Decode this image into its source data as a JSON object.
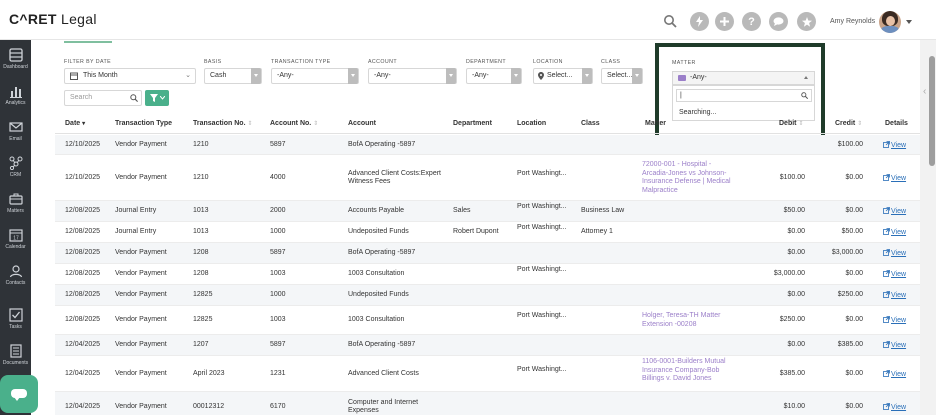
{
  "app": {
    "logo_main": "C^RET",
    "logo_sub": " Legal"
  },
  "header": {
    "user_name": "Amy Reynolds",
    "icons": [
      "search-icon",
      "bolt-icon",
      "plus-icon",
      "help-icon",
      "chat-icon",
      "star-icon"
    ]
  },
  "sidebar": {
    "items": [
      {
        "label": "Dashboard",
        "icon": "dashboard-icon"
      },
      {
        "label": "Analytics",
        "icon": "analytics-icon"
      },
      {
        "label": "Email",
        "icon": "email-icon"
      },
      {
        "label": "CRM",
        "icon": "crm-icon"
      },
      {
        "label": "Matters",
        "icon": "matters-icon"
      },
      {
        "label": "Calendar",
        "icon": "calendar-icon"
      },
      {
        "label": "Contacts",
        "icon": "contacts-icon"
      },
      {
        "label": "Tasks",
        "icon": "tasks-icon"
      },
      {
        "label": "Documents",
        "icon": "documents-icon"
      }
    ]
  },
  "filters": {
    "filter_by_date": {
      "label": "FILTER BY DATE",
      "value": "This Month"
    },
    "basis": {
      "label": "BASIS",
      "value": "Cash"
    },
    "transaction_type": {
      "label": "TRANSACTION TYPE",
      "value": "-Any-"
    },
    "account": {
      "label": "ACCOUNT",
      "value": "-Any-"
    },
    "department": {
      "label": "DEPARTMENT",
      "value": "-Any-"
    },
    "location": {
      "label": "LOCATION",
      "value": "Select..."
    },
    "class": {
      "label": "CLASS",
      "value": "Select..."
    },
    "matter": {
      "label": "MATTER",
      "value": "-Any-",
      "search_value": "|",
      "status": "Searching..."
    },
    "search_placeholder": "Search"
  },
  "table": {
    "headers": {
      "date": "Date",
      "transaction_type": "Transaction Type",
      "transaction_no": "Transaction No.",
      "account_no": "Account No.",
      "account": "Account",
      "department": "Department",
      "location": "Location",
      "class": "Class",
      "matter": "Matter",
      "debit": "Debit",
      "credit": "Credit",
      "details": "Details"
    },
    "view_label": "View",
    "rows": [
      {
        "date": "12/10/2025",
        "type": "Vendor Payment",
        "txn": "1210",
        "acct_no": "5897",
        "account": "BofA Operating -5897",
        "department": "",
        "location": "",
        "class": "",
        "matter": "",
        "debit": "",
        "credit": "$100.00"
      },
      {
        "date": "12/10/2025",
        "type": "Vendor Payment",
        "txn": "1210",
        "acct_no": "4000",
        "account": "Advanced Client Costs:Expert Witness Fees",
        "department": "",
        "location": "Port Washingt...",
        "class": "",
        "matter": "72000-001 - Hospital - Arcadia-Jones vs Johnson-Insurance Defense | Medical Malpractice",
        "debit": "$100.00",
        "credit": "$0.00"
      },
      {
        "date": "12/08/2025",
        "type": "Journal Entry",
        "txn": "1013",
        "acct_no": "2000",
        "account": "Accounts Payable",
        "department": "Sales",
        "location": "Port Washingt...",
        "class": "Business Law",
        "matter": "",
        "debit": "$50.00",
        "credit": "$0.00"
      },
      {
        "date": "12/08/2025",
        "type": "Journal Entry",
        "txn": "1013",
        "acct_no": "1000",
        "account": "Undeposited Funds",
        "department": "Robert Dupont",
        "location": "Port Washingt...",
        "class": "Attorney 1",
        "matter": "",
        "debit": "$0.00",
        "credit": "$50.00"
      },
      {
        "date": "12/08/2025",
        "type": "Vendor Payment",
        "txn": "1208",
        "acct_no": "5897",
        "account": "BofA Operating -5897",
        "department": "",
        "location": "",
        "class": "",
        "matter": "",
        "debit": "$0.00",
        "credit": "$3,000.00"
      },
      {
        "date": "12/08/2025",
        "type": "Vendor Payment",
        "txn": "1208",
        "acct_no": "1003",
        "account": "1003 Consultation",
        "department": "",
        "location": "Port Washingt...",
        "class": "",
        "matter": "",
        "debit": "$3,000.00",
        "credit": "$0.00"
      },
      {
        "date": "12/08/2025",
        "type": "Vendor Payment",
        "txn": "12825",
        "acct_no": "1000",
        "account": "Undeposited Funds",
        "department": "",
        "location": "",
        "class": "",
        "matter": "",
        "debit": "$0.00",
        "credit": "$250.00"
      },
      {
        "date": "12/08/2025",
        "type": "Vendor Payment",
        "txn": "12825",
        "acct_no": "1003",
        "account": "1003 Consultation",
        "department": "",
        "location": "Port Washingt...",
        "class": "",
        "matter": "Holger, Teresa-TH Matter Extension -00208",
        "debit": "$250.00",
        "credit": "$0.00"
      },
      {
        "date": "12/04/2025",
        "type": "Vendor Payment",
        "txn": "1207",
        "acct_no": "5897",
        "account": "BofA Operating -5897",
        "department": "",
        "location": "",
        "class": "",
        "matter": "",
        "debit": "$0.00",
        "credit": "$385.00"
      },
      {
        "date": "12/04/2025",
        "type": "Vendor Payment",
        "txn": "April 2023",
        "acct_no": "1231",
        "account": "Advanced Client Costs",
        "department": "",
        "location": "Port Washingt...",
        "class": "",
        "matter": "1106-0001-Builders Mutual Insurance Company-Bob Billings v. David Jones",
        "debit": "$385.00",
        "credit": "$0.00"
      },
      {
        "date": "12/04/2025",
        "type": "Vendor Payment",
        "txn": "00012312",
        "acct_no": "6170",
        "account": "Computer and Internet Expenses",
        "department": "",
        "location": "",
        "class": "",
        "matter": "",
        "debit": "$10.00",
        "credit": "$0.00"
      }
    ]
  }
}
